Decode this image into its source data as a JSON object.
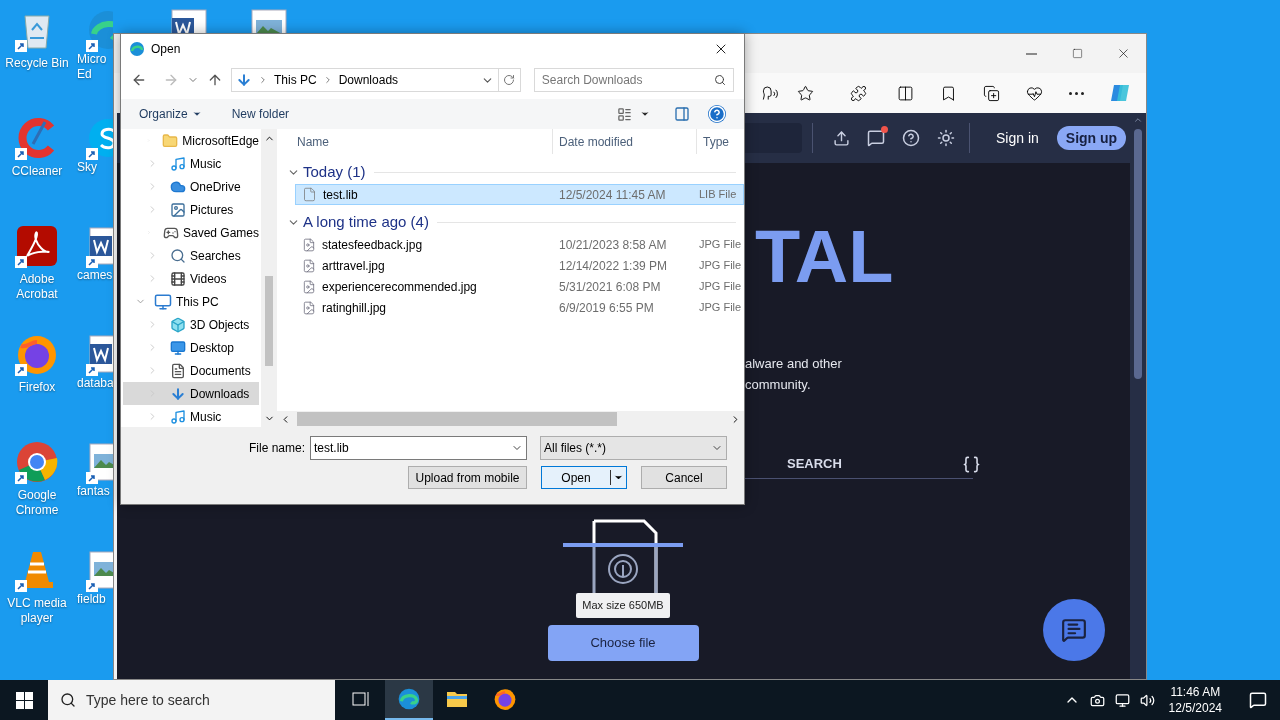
{
  "desktop": {
    "icons": [
      {
        "label": "Recycle Bin",
        "kind": "recycle"
      },
      {
        "label": "CCleaner",
        "kind": "ccleaner"
      },
      {
        "label": "Adobe Acrobat",
        "kind": "acrobat"
      },
      {
        "label": "Firefox",
        "kind": "firefox"
      },
      {
        "label": "Google Chrome",
        "kind": "chrome"
      },
      {
        "label": "VLC media player",
        "kind": "vlc"
      }
    ],
    "icons_column_2": [
      {
        "lines": [
          "Micro",
          "Ed"
        ],
        "kind": "edge"
      },
      {
        "lines": [
          "Sky"
        ],
        "kind": "skype"
      },
      {
        "lines": [
          "cames"
        ],
        "kind": "word"
      },
      {
        "lines": [
          "databa"
        ],
        "kind": "word"
      },
      {
        "lines": [
          "fantas"
        ],
        "kind": "image"
      },
      {
        "lines": [
          "fieldb"
        ],
        "kind": "image"
      }
    ],
    "top_icons": [
      {
        "kind": "word"
      },
      {
        "kind": "image"
      }
    ]
  },
  "browser": {
    "header": {
      "sign_in": "Sign in",
      "sign_up": "Sign up"
    },
    "hero_title": "TAL",
    "hero_text": [
      "alware and other",
      "community."
    ],
    "search_tab": "SEARCH",
    "upload": {
      "tooltip": "Max size 650MB",
      "button": "Choose file"
    }
  },
  "dialog": {
    "title": "Open",
    "path": [
      "This PC",
      "Downloads"
    ],
    "search_placeholder": "Search Downloads",
    "toolbar": [
      {
        "label": "Organize",
        "dropdown": true
      },
      {
        "label": "New folder",
        "dropdown": false
      }
    ],
    "nav_groups": [
      {
        "items": [
          {
            "label": "MicrosoftEdge",
            "kind": "folder",
            "selected": false
          },
          {
            "label": "Music",
            "kind": "music",
            "selected": false
          },
          {
            "label": "OneDrive",
            "kind": "cloud",
            "selected": false
          },
          {
            "label": "Pictures",
            "kind": "pictures",
            "selected": false
          },
          {
            "label": "Saved Games",
            "kind": "games",
            "selected": false
          },
          {
            "label": "Searches",
            "kind": "search",
            "selected": false
          },
          {
            "label": "Videos",
            "kind": "videos",
            "selected": false
          }
        ]
      },
      {
        "label": "This PC",
        "expanded": true,
        "items": [
          {
            "label": "3D Objects",
            "kind": "objects",
            "selected": false
          },
          {
            "label": "Desktop",
            "kind": "desktop",
            "selected": false
          },
          {
            "label": "Documents",
            "kind": "documents",
            "selected": false
          },
          {
            "label": "Downloads",
            "kind": "downloads",
            "selected": true
          },
          {
            "label": "Music",
            "kind": "music",
            "selected": false
          }
        ]
      }
    ],
    "columns": [
      "Name",
      "Date modified",
      "Type"
    ],
    "groups": [
      {
        "label": "Today (1)",
        "expanded": true,
        "files": [
          {
            "name": "test.lib",
            "date": "12/5/2024 11:45 AM",
            "type": "LIB File",
            "kind": "blank",
            "selected": true
          }
        ]
      },
      {
        "label": "A long time ago (4)",
        "expanded": true,
        "files": [
          {
            "name": "statesfeedback.jpg",
            "date": "10/21/2023 8:58 AM",
            "type": "JPG File",
            "kind": "image",
            "selected": false
          },
          {
            "name": "arttravel.jpg",
            "date": "12/14/2022 1:39 PM",
            "type": "JPG File",
            "kind": "image",
            "selected": false
          },
          {
            "name": "experiencerecommended.jpg",
            "date": "5/31/2021 6:08 PM",
            "type": "JPG File",
            "kind": "image",
            "selected": false
          },
          {
            "name": "ratinghill.jpg",
            "date": "6/9/2019 6:55 PM",
            "type": "JPG File",
            "kind": "image",
            "selected": false
          }
        ]
      }
    ],
    "file_name_label": "File name:",
    "file_name": "test.lib",
    "file_type": "All files (*.*)",
    "buttons": [
      "Upload from mobile",
      "Open",
      "Cancel"
    ]
  },
  "taskbar": {
    "search_placeholder": "Type here to search",
    "apps": [
      {
        "kind": "taskview",
        "active": false
      },
      {
        "kind": "edge",
        "active": true
      },
      {
        "kind": "explorer",
        "active": false
      },
      {
        "kind": "firefox",
        "active": false
      }
    ],
    "time": "11:46 AM",
    "date": "12/5/2024"
  }
}
